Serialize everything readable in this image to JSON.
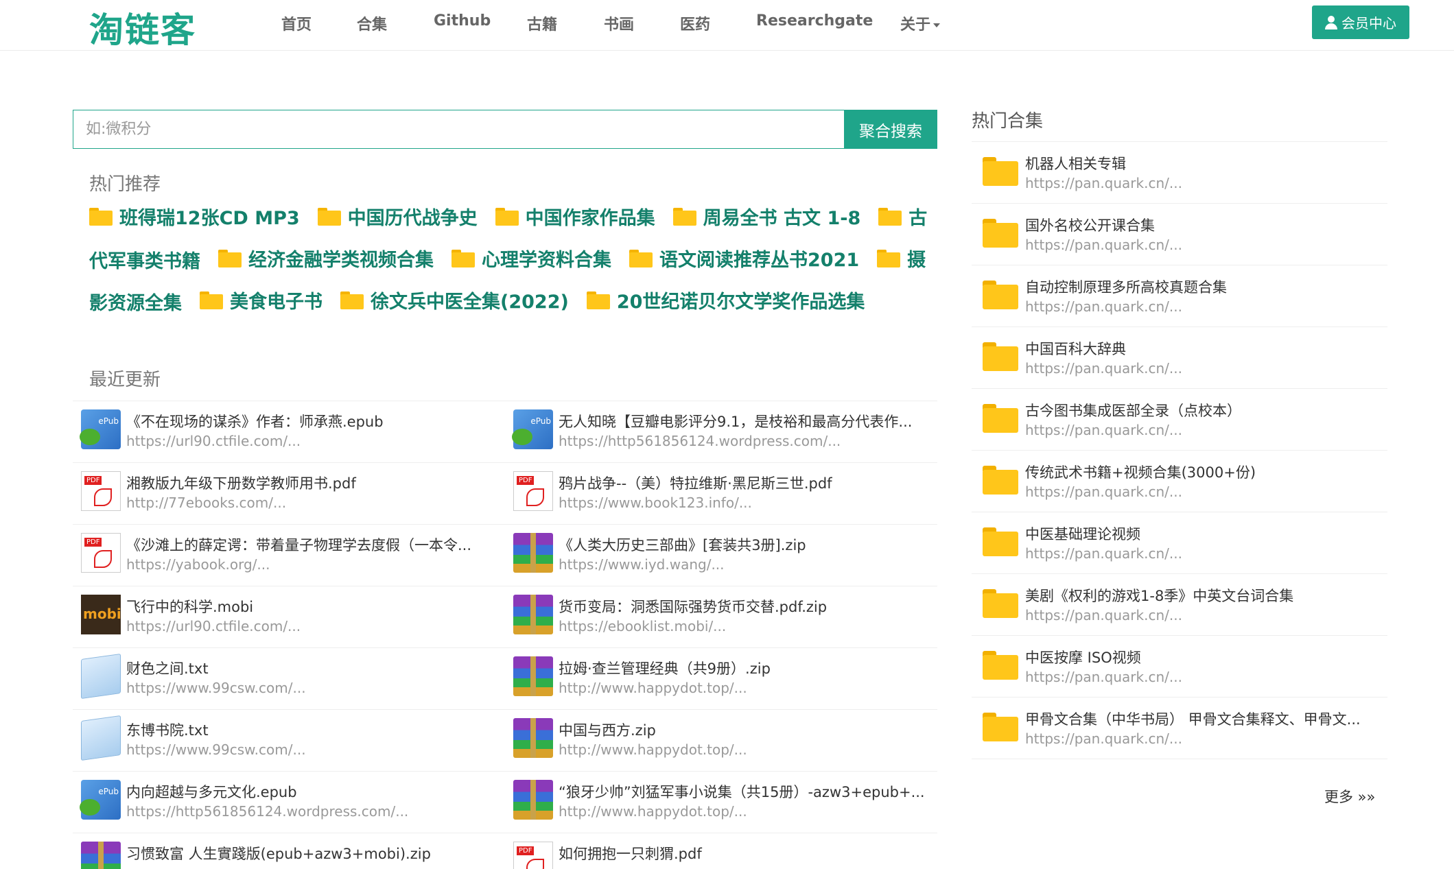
{
  "header": {
    "logo": "淘链客",
    "nav": [
      "首页",
      "合集",
      "Github",
      "古籍",
      "书画",
      "医药",
      "Researchgate",
      "关于"
    ],
    "member_button": "会员中心"
  },
  "search": {
    "placeholder": "如:微积分",
    "button": "聚合搜索"
  },
  "hot": {
    "title": "热门推荐",
    "lines": [
      [
        "班得瑞12张CD MP3",
        "中国历代战争史",
        "中国作家作品集",
        "周易全书 古文 1-8",
        "古"
      ],
      [
        "代军事类书籍",
        "经济金融学类视频合集",
        "心理学资料合集",
        "语文阅读推荐丛书2021",
        "摄"
      ],
      [
        "影资源全集",
        "美食电子书",
        "徐文兵中医全集(2022)",
        "20世纪诺贝尔文学奖作品选集"
      ]
    ]
  },
  "recent": {
    "title": "最近更新",
    "rows": [
      [
        {
          "icon": "epub-icon",
          "name": "《不在现场的谋杀》作者：师承燕.epub",
          "url": "https://url90.ctfile.com/..."
        },
        {
          "icon": "epub-icon",
          "name": "无人知晓【豆瓣电影评分9.1，是枝裕和最高分代表作...",
          "url": "https://http561856124.wordpress.com/..."
        }
      ],
      [
        {
          "icon": "pdf-icon",
          "name": "湘教版九年级下册数学教师用书.pdf",
          "url": "http://77ebooks.com/..."
        },
        {
          "icon": "pdf-icon",
          "name": "鸦片战争--（美）特拉维斯·黑尼斯三世.pdf",
          "url": "https://www.book123.info/..."
        }
      ],
      [
        {
          "icon": "pdf-icon",
          "name": "《沙滩上的薛定谔：带着量子物理学去度假（一本令...",
          "url": "https://yabook.org/..."
        },
        {
          "icon": "zip-icon",
          "name": "《人类大历史三部曲》[套装共3册].zip",
          "url": "https://www.iyd.wang/..."
        }
      ],
      [
        {
          "icon": "mobi-icon",
          "name": "飞行中的科学.mobi",
          "url": "https://url90.ctfile.com/..."
        },
        {
          "icon": "zip-icon",
          "name": "货币变局：洞悉国际强势货币交替.pdf.zip",
          "url": "https://ebooklist.mobi/..."
        }
      ],
      [
        {
          "icon": "txt-icon",
          "name": "财色之间.txt",
          "url": "https://www.99csw.com/..."
        },
        {
          "icon": "zip-icon",
          "name": "拉姆·查兰管理经典（共9册）.zip",
          "url": "http://www.happydot.top/..."
        }
      ],
      [
        {
          "icon": "txt-icon",
          "name": "东博书院.txt",
          "url": "https://www.99csw.com/..."
        },
        {
          "icon": "zip-icon",
          "name": "中国与西方.zip",
          "url": "http://www.happydot.top/..."
        }
      ],
      [
        {
          "icon": "epub-icon",
          "name": "内向超越与多元文化.epub",
          "url": "https://http561856124.wordpress.com/..."
        },
        {
          "icon": "zip-icon",
          "name": "“狼牙少帅”刘猛军事小说集（共15册）-azw3+epub+...",
          "url": "http://www.happydot.top/..."
        }
      ],
      [
        {
          "icon": "zip-icon",
          "name": "习惯致富 人生實踐版(epub+azw3+mobi).zip",
          "url": ""
        },
        {
          "icon": "pdf-icon",
          "name": "如何拥抱一只刺猬.pdf",
          "url": ""
        }
      ]
    ]
  },
  "collections": {
    "title": "热门合集",
    "items": [
      {
        "name": "机器人相关专辑",
        "url": "https://pan.quark.cn/..."
      },
      {
        "name": "国外名校公开课合集",
        "url": "https://pan.quark.cn/..."
      },
      {
        "name": "自动控制原理多所高校真题合集",
        "url": "https://pan.quark.cn/..."
      },
      {
        "name": "中国百科大辞典",
        "url": "https://pan.quark.cn/..."
      },
      {
        "name": "古今图书集成医部全录（点校本）",
        "url": "https://pan.quark.cn/..."
      },
      {
        "name": "传统武术书籍+视频合集(3000+份)",
        "url": "https://pan.quark.cn/..."
      },
      {
        "name": "中医基础理论视频",
        "url": "https://pan.quark.cn/..."
      },
      {
        "name": "美剧《权利的游戏1-8季》中英文台词合集",
        "url": "https://pan.quark.cn/..."
      },
      {
        "name": "中医按摩 ISO视频",
        "url": "https://pan.quark.cn/..."
      },
      {
        "name": "甲骨文合集（中华书局） 甲骨文合集释文、甲骨文...",
        "url": "https://pan.quark.cn/..."
      }
    ],
    "more": "更多 »»"
  },
  "colors": {
    "accent": "#1fa58a",
    "hot_text": "#14806b",
    "folder": "#ffc61a"
  }
}
